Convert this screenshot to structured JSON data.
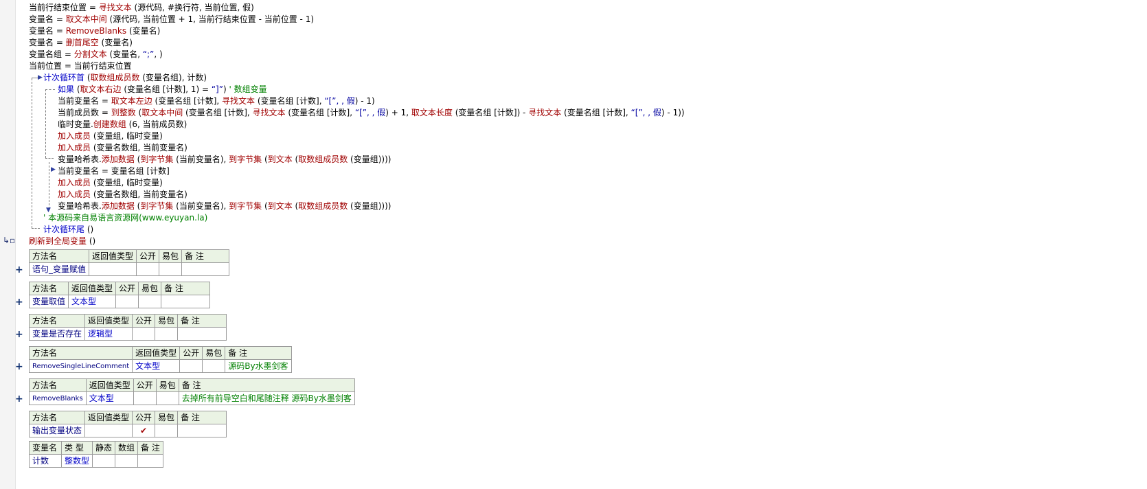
{
  "code": {
    "l1": {
      "a": "当前行结束位置 = ",
      "b": "寻找文本",
      "c": " (源代码, #换行符, 当前位置, 假)"
    },
    "l2": {
      "a": "变量名 = ",
      "b": "取文本中间",
      "c": " (源代码, 当前位置 + 1, 当前行结束位置 - 当前位置 - 1)"
    },
    "l3": {
      "a": "变量名 = ",
      "b": "RemoveBlanks",
      "c": " (变量名)"
    },
    "l4": {
      "a": "变量名 = ",
      "b": "删首尾空",
      "c": " (变量名)"
    },
    "l5": {
      "a": "变量名组 = ",
      "b": "分割文本",
      "c": " (变量名, ",
      "d": "“;”",
      "e": ", )"
    },
    "l6": {
      "a": "当前位置 = 当前行结束位置"
    },
    "l7": {
      "a": "计次循环首",
      "b": " (",
      "c": "取数组成员数",
      "d": " (变量名组), 计数)"
    },
    "l8": {
      "a": "如果",
      "b": " (",
      "c": "取文本右边",
      "d": " (变量名组 [计数], 1) = ",
      "e": "“]”",
      "f": ") ",
      "g": "' 数组变量"
    },
    "l9": {
      "a": "当前变量名 = ",
      "b": "取文本左边",
      "c": " (变量名组 [计数], ",
      "d": "寻找文本",
      "e": " (变量名组 [计数], ",
      "f": "“[”, , 假",
      "g": ") - 1)"
    },
    "l10": {
      "a": "当前成员数 = ",
      "b": "到整数",
      "c": " (",
      "d": "取文本中间",
      "e": " (变量名组 [计数], ",
      "f": "寻找文本",
      "g": " (变量名组 [计数], ",
      "h": "“[”, , 假",
      "i": ") + 1, ",
      "j": "取文本长度",
      "k": " (变量名组 [计数]) - ",
      "l": "寻找文本",
      "m": " (变量名组 [计数], ",
      "n": "“[”, , 假",
      "o": ") - 1))"
    },
    "l11": {
      "a": "临时变量.",
      "b": "创建数组",
      "c": " (6, 当前成员数)"
    },
    "l12": {
      "a": "加入成员",
      "b": " (变量组, 临时变量)"
    },
    "l13": {
      "a": "加入成员",
      "b": " (变量名数组, 当前变量名)"
    },
    "l14": {
      "a": "变量哈希表.",
      "b": "添加数据",
      "c": " (",
      "d": "到字节集",
      "e": " (当前变量名), ",
      "f": "到字节集",
      "g": " (",
      "h": "到文本",
      "i": " (",
      "j": "取数组成员数",
      "k": " (变量组))))"
    },
    "l15": {
      "a": "当前变量名 = 变量名组 [计数]"
    },
    "l16": {
      "a": "加入成员",
      "b": " (变量组, 临时变量)"
    },
    "l17": {
      "a": "加入成员",
      "b": " (变量名数组, 当前变量名)"
    },
    "l18": {
      "a": "变量哈希表.",
      "b": "添加数据",
      "c": " (",
      "d": "到字节集",
      "e": " (当前变量名), ",
      "f": "到字节集",
      "g": " (",
      "h": "到文本",
      "i": " (",
      "j": "取数组成员数",
      "k": " (变量组))))"
    },
    "l19": {
      "a": "' 本源码来自易语言资源网(www.eyuyan.la)"
    },
    "l20": {
      "a": "计次循环尾",
      "b": " ()"
    },
    "l21": {
      "a": "刷新到全局变量",
      "b": " ()"
    }
  },
  "methods": {
    "headers": {
      "name": "方法名",
      "ret": "返回值类型",
      "pub": "公开",
      "easy": "易包",
      "note": "备 注"
    },
    "m1": {
      "name": "语句_变量赋值",
      "ret": "",
      "note": ""
    },
    "m2": {
      "name": "变量取值",
      "ret": "文本型",
      "note": ""
    },
    "m3": {
      "name": "变量是否存在",
      "ret": "逻辑型",
      "note": ""
    },
    "m4": {
      "name": "RemoveSingleLineComment",
      "ret": "文本型",
      "note": "源码By水墨剑客"
    },
    "m5": {
      "name": "RemoveBlanks",
      "ret": "文本型",
      "note": "去掉所有前导空白和尾随注释 源码By水墨剑客"
    },
    "m6": {
      "name": "输出变量状态",
      "ret": "",
      "pub_check": "✔",
      "note": ""
    },
    "plus": "+"
  },
  "vars": {
    "headers": {
      "name": "变量名",
      "type": "类 型",
      "static": "静态",
      "arr": "数组",
      "note": "备 注"
    },
    "row1": {
      "name": "计数",
      "type": "整数型"
    }
  }
}
